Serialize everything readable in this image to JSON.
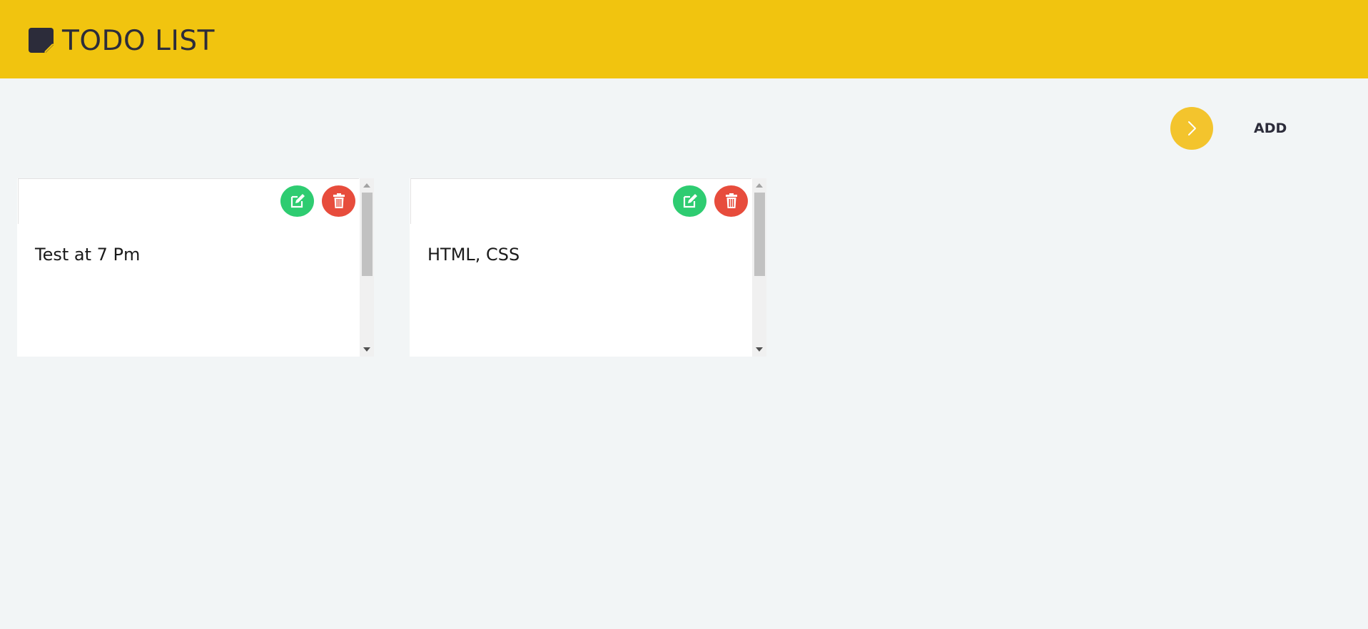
{
  "header": {
    "title": "TODO LIST",
    "logo_icon": "sticky-note-icon",
    "background": "#f1c40f"
  },
  "toolbar": {
    "add_label": "ADD",
    "add_icon": "chevron-right-icon",
    "add_color": "#f3c42d"
  },
  "notes": [
    {
      "text": "Test at 7 Pm",
      "edit_icon": "edit-icon",
      "delete_icon": "trash-icon"
    },
    {
      "text": "HTML, CSS",
      "edit_icon": "edit-icon",
      "delete_icon": "trash-icon"
    }
  ],
  "colors": {
    "edit": "#2ecc71",
    "delete": "#e74c3c",
    "page_background": "#f2f5f6"
  }
}
